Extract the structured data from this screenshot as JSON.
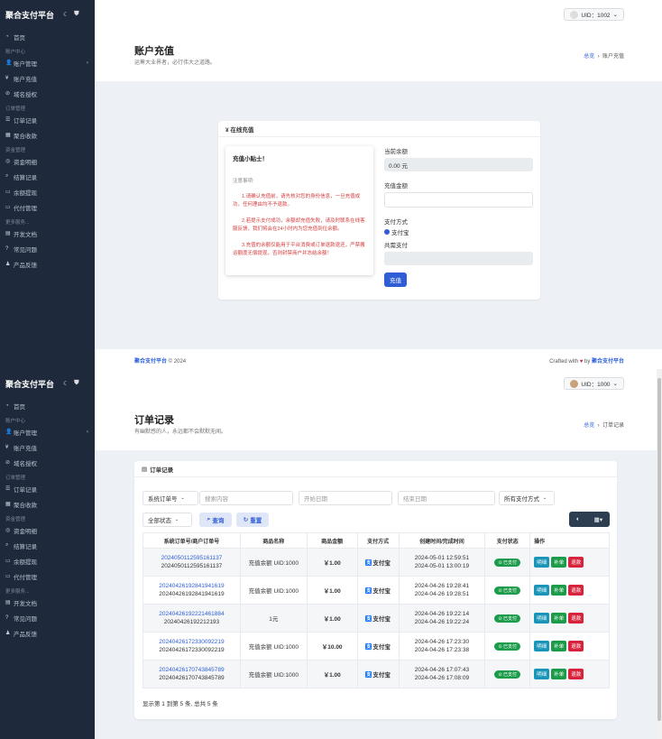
{
  "app": {
    "brand": "聚合支付平台",
    "uid1": "UID：1002",
    "uid2": "UID：1000"
  },
  "sidebar": {
    "home": "首页",
    "sec_account": "账户中心",
    "account_manage": "账户管理",
    "account_recharge": "账户充值",
    "domain_auth": "域名授权",
    "sec_order": "订单管理",
    "order_records": "订单记录",
    "agg_collect": "聚合收款",
    "sec_funds": "资金管理",
    "funds_detail": "资金明细",
    "settle_records": "结算记录",
    "balance_withdraw": "余额提现",
    "agent_manage": "代付管理",
    "sec_more": "更多服务...",
    "dev_docs": "开发文档",
    "faq": "常见问题",
    "product_feedback": "产品反馈"
  },
  "recharge_page": {
    "title": "账户充值",
    "subtitle": "运筹大业界者，必行伟大之道路。",
    "bc_home": "总览",
    "bc_current": "账户充值",
    "card_title": "¥ 在线充值",
    "tip_title": "充值小贴士！",
    "tip_note": "注意事项:",
    "tip_p1": "1.请确认充值前，请先核对您的身份信息，一旦充值成功，任何理由均不予退款。",
    "tip_p2": "2.若提示支付成功，余额却充值失败，请及时联系在线客服反馈，我们将会在24小时内为您充值到位余额。",
    "tip_p3": "3.充值的余额仅能用于平台消费或订单退款退还，严禁搬运额度无偿提现，否则封禁商户并冻结余额！",
    "balance_label": "当前余额",
    "balance_value": "0.00 元",
    "amount_label": "充值金额",
    "pay_method_label": "支付方式",
    "pay_method_option": "支付宝",
    "total_label": "共需支付",
    "submit": "充值",
    "footer_brand": "聚合支付平台",
    "footer_year": " © 2024",
    "footer_crafted": "Crafted with",
    "footer_by": " by ",
    "footer_brand2": "聚合支付平台"
  },
  "orders_page": {
    "title": "订单记录",
    "subtitle": "有幽默感的人，永远都不会默默无闻。",
    "bc_home": "总览",
    "bc_current": "订单记录",
    "card_title": "订单记录",
    "filter_type": "系统订单号",
    "search_placeholder": "搜索内容",
    "start_date": "开始日期",
    "end_date": "结束日期",
    "pay_type": "所有支付方式",
    "status": "全部状态",
    "query": "查询",
    "reset": "重置",
    "headers": [
      "系统订单号/商户订单号",
      "商品名称",
      "商品金额",
      "支付方式",
      "创建时间/完成时间",
      "支付状态",
      "操作"
    ],
    "rows": [
      {
        "sys": "2024050112595161137",
        "mch": "2024050112595161137",
        "name": "充值余额 UID:1000",
        "amount": "￥1.00",
        "pay": "支付宝",
        "created": "2024-05-01 12:59:51",
        "done": "2024-05-01 13:00:19",
        "status": "已支付"
      },
      {
        "sys": "20240426192841941619",
        "mch": "20240426192841941619",
        "name": "充值余额 UID:1000",
        "amount": "￥1.00",
        "pay": "支付宝",
        "created": "2024-04-26 19:28:41",
        "done": "2024-04-26 19:28:51",
        "status": "已支付"
      },
      {
        "sys": "20240426192221461884",
        "mch": "20240426192212193",
        "name": "1元",
        "amount": "￥1.00",
        "pay": "支付宝",
        "created": "2024-04-26 19:22:14",
        "done": "2024-04-26 19:22:24",
        "status": "已支付"
      },
      {
        "sys": "20240426172330092219",
        "mch": "20240426172330092219",
        "name": "充值余额 UID:1000",
        "amount": "￥10.00",
        "pay": "支付宝",
        "created": "2024-04-26 17:23:30",
        "done": "2024-04-26 17:23:38",
        "status": "已支付"
      },
      {
        "sys": "20240426170743845789",
        "mch": "20240426170743845789",
        "name": "充值余额 UID:1000",
        "amount": "￥1.00",
        "pay": "支付宝",
        "created": "2024-04-26 17:07:43",
        "done": "2024-04-26 17:08:09",
        "status": "已支付"
      }
    ],
    "ops": [
      "明细",
      "补单",
      "退款"
    ],
    "summary": "显示第 1 到第 5 条, 总共 5 条"
  }
}
